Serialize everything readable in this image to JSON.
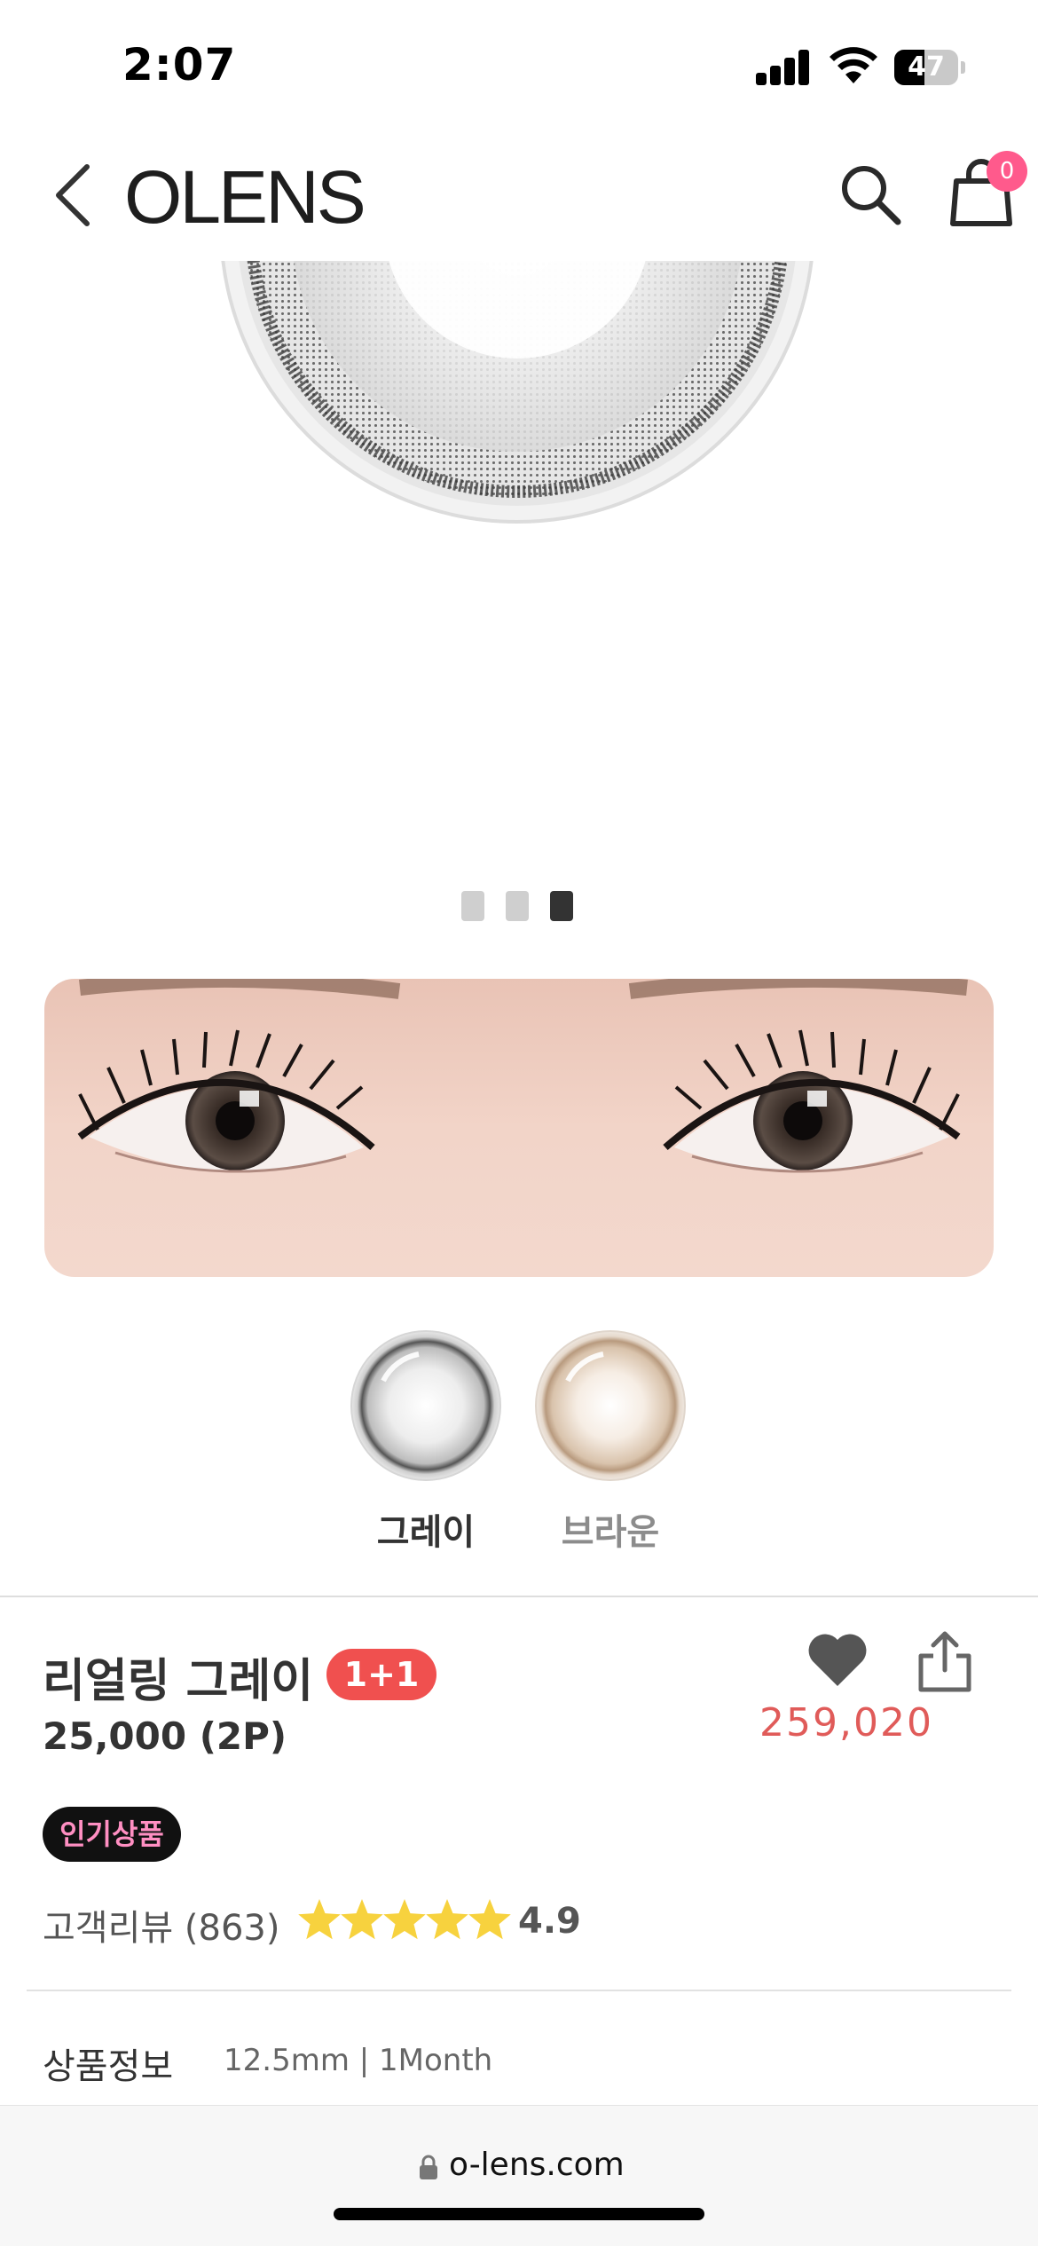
{
  "status_bar": {
    "time": "2:07",
    "battery_level": "47",
    "battery_fraction": 0.47
  },
  "header": {
    "logo": "OLENS",
    "cart_count": "0",
    "icons": [
      "chevron-left-icon",
      "search-icon",
      "cart-icon"
    ]
  },
  "gallery": {
    "slides": 3,
    "active_slide": 3
  },
  "colors": {
    "options": [
      {
        "label": "그레이",
        "selected": true
      },
      {
        "label": "브라운",
        "selected": false
      }
    ]
  },
  "product": {
    "name": "리얼링 그레이",
    "promo_badge": "1+1",
    "price": "25,000 (2P)",
    "like_count": "259,020",
    "popular_tag": "인기상품",
    "review_label": "고객리뷰 (863)",
    "rating": "4.9",
    "star_count": 5,
    "spec_label": "상품정보",
    "spec_value": "12.5mm | 1Month"
  },
  "browser": {
    "url": "o-lens.com"
  },
  "theme": {
    "accent_red": "#f0504f",
    "like_red": "#e05b59",
    "badge_pink": "#ff5a8c",
    "tag_pink": "#ff8fc2",
    "star_yellow": "#f7d23e"
  }
}
